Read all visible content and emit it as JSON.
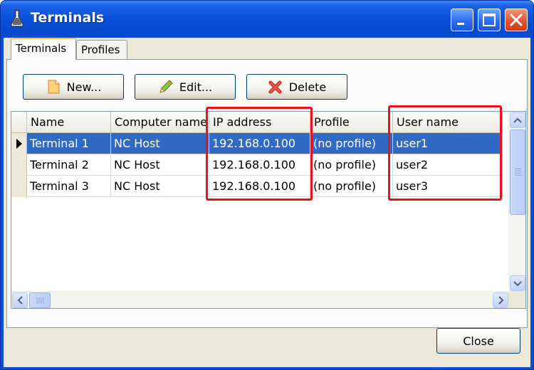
{
  "window": {
    "title": "Terminals",
    "icon": "flask-app-icon",
    "controls": [
      "minimize-icon",
      "maximize-icon",
      "close-icon"
    ]
  },
  "tabs": [
    {
      "label": "Terminals",
      "active": true
    },
    {
      "label": "Profiles",
      "active": false
    }
  ],
  "toolbar": {
    "new_label": "New...",
    "edit_label": "Edit...",
    "delete_label": "Delete"
  },
  "table": {
    "columns": [
      "Name",
      "Computer name",
      "IP address",
      "Profile",
      "User name"
    ],
    "rows": [
      {
        "name": "Terminal 1",
        "computer": "NC Host",
        "ip": "192.168.0.100",
        "profile": "(no profile)",
        "user": "user1",
        "selected": true
      },
      {
        "name": "Terminal 2",
        "computer": "NC Host",
        "ip": "192.168.0.100",
        "profile": "(no profile)",
        "user": "user2",
        "selected": false
      },
      {
        "name": "Terminal 3",
        "computer": "NC Host",
        "ip": "192.168.0.100",
        "profile": "(no profile)",
        "user": "user3",
        "selected": false
      }
    ]
  },
  "footer": {
    "close_label": "Close"
  },
  "colors": {
    "titlebar": "#0a52dc",
    "selection": "#316ac5",
    "annotation": "#e8121a",
    "face": "#ece9d8"
  }
}
